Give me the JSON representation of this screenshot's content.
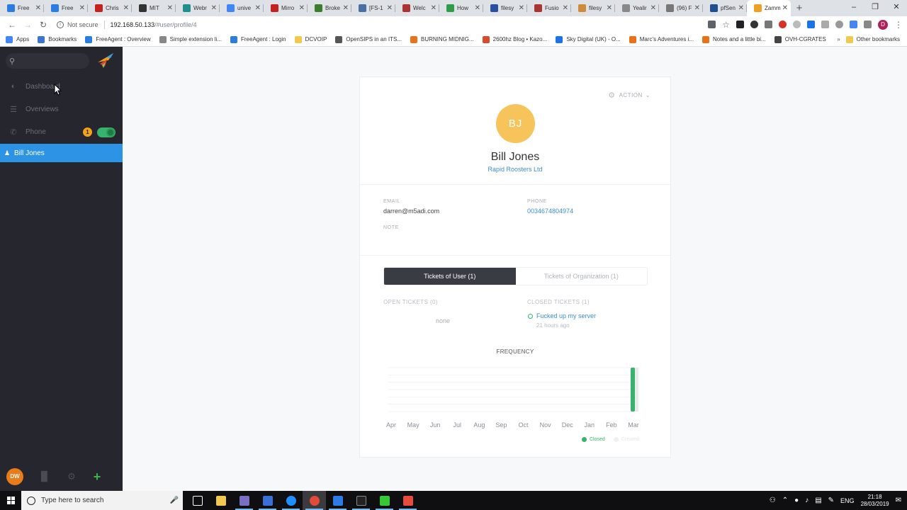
{
  "browser": {
    "tabs": [
      {
        "label": "Free",
        "color": "#2a7de1"
      },
      {
        "label": "Free",
        "color": "#2a7de1"
      },
      {
        "label": "Chris",
        "color": "#c5221f"
      },
      {
        "label": "MIT",
        "color": "#333333"
      },
      {
        "label": "Webr",
        "color": "#1e8e8e"
      },
      {
        "label": "unive",
        "color": "#4285f4"
      },
      {
        "label": "Mirro",
        "color": "#c5221f"
      },
      {
        "label": "Broke",
        "color": "#3a7d2c"
      },
      {
        "label": "[FS-1",
        "color": "#4a6fa5"
      },
      {
        "label": "Welc",
        "color": "#a33"
      },
      {
        "label": "How",
        "color": "#2e9d47"
      },
      {
        "label": "filesy",
        "color": "#2a4fa0"
      },
      {
        "label": "Fusio",
        "color": "#a33"
      },
      {
        "label": "filesy",
        "color": "#d08b3a"
      },
      {
        "label": "Yealir",
        "color": "#888888"
      },
      {
        "label": "(96) F",
        "color": "#777777"
      },
      {
        "label": "pfSen",
        "color": "#1d4f91"
      },
      {
        "label": "Zamm",
        "color": "#f0a020"
      }
    ],
    "active_tab": "Zamm",
    "security_label": "Not secure",
    "url_host": "192.168.50.133",
    "url_path": "/#user/profile/4",
    "profile_initial": "D",
    "bookmarks": [
      {
        "label": "Apps",
        "color": "#4285f4"
      },
      {
        "label": "Bookmarks",
        "color": "#3b73d6"
      },
      {
        "label": "FreeAgent : Overview",
        "color": "#2a7de1"
      },
      {
        "label": "Simple extension li...",
        "color": "#888888"
      },
      {
        "label": "FreeAgent : Login",
        "color": "#2a7de1"
      },
      {
        "label": "DCVOIP",
        "color": "#f2c94c"
      },
      {
        "label": "OpenSIPS in an ITS...",
        "color": "#555555"
      },
      {
        "label": "BURNING MIDNIG...",
        "color": "#e8711a"
      },
      {
        "label": "2600hz Blog • Kazo...",
        "color": "#d94b2b"
      },
      {
        "label": "Sky Digital (UK) - O...",
        "color": "#1a73e8"
      },
      {
        "label": "Marc's Adventures i...",
        "color": "#e8711a"
      },
      {
        "label": "Notes and a little bi...",
        "color": "#e8711a"
      },
      {
        "label": "OVH-CGRATES",
        "color": "#444444"
      }
    ],
    "other_bookmarks": "Other bookmarks"
  },
  "sidebar": {
    "search_placeholder": "",
    "items": [
      {
        "label": "Dashboard",
        "icon": "dashboard-icon"
      },
      {
        "label": "Overviews",
        "icon": "list-icon"
      },
      {
        "label": "Phone",
        "icon": "phone-icon"
      }
    ],
    "phone_badge": "1",
    "phone_toggle_on": true,
    "active_user": "Bill Jones",
    "user_initials": "DW"
  },
  "profile": {
    "action_label": "ACTION",
    "initials": "BJ",
    "name": "Bill Jones",
    "organization": "Rapid Roosters Ltd",
    "email_label": "EMAIL",
    "email": "darren@m5adi.com",
    "phone_label": "PHONE",
    "phone": "0034674804974",
    "note_label": "NOTE",
    "tabs": {
      "user": "Tickets of User (1)",
      "org": "Tickets of Organization (1)"
    },
    "open_tickets_label": "OPEN TICKETS (0)",
    "open_tickets_empty": "none",
    "closed_tickets_label": "CLOSED TICKETS (1)",
    "closed_ticket_title": "Fucked up my server",
    "closed_ticket_time": "21 hours ago",
    "colors": {
      "accent": "#3b8fd4",
      "avatar": "#f6c45a",
      "closed": "#38b36c"
    }
  },
  "chart_data": {
    "type": "bar",
    "title": "FREQUENCY",
    "categories": [
      "Apr",
      "May",
      "Jun",
      "Jul",
      "Aug",
      "Sep",
      "Oct",
      "Nov",
      "Dec",
      "Jan",
      "Feb",
      "Mar"
    ],
    "series": [
      {
        "name": "Closed",
        "values": [
          0,
          0,
          0,
          0,
          0,
          0,
          0,
          0,
          0,
          0,
          0,
          1
        ],
        "color": "#38b36c"
      },
      {
        "name": "Created",
        "values": [
          0,
          0,
          0,
          0,
          0,
          0,
          0,
          0,
          0,
          0,
          0,
          1
        ],
        "color": "#e8eaed"
      }
    ],
    "ylim": [
      0,
      1
    ],
    "grid": true,
    "legend": "bottom-right"
  },
  "taskbar": {
    "search_placeholder": "Type here to search",
    "language": "ENG",
    "time": "21:18",
    "date": "28/03/2019"
  }
}
